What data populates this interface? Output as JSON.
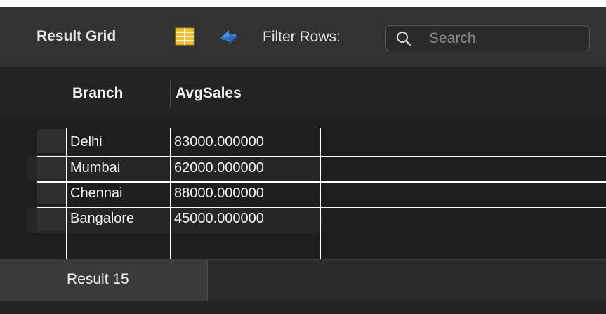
{
  "toolbar": {
    "title": "Result Grid",
    "grid_icon": "form-editor-icon",
    "refresh_icon": "refresh-icon",
    "filter_label": "Filter Rows:",
    "search_icon": "search-icon",
    "search_placeholder": "Search"
  },
  "grid": {
    "columns": [
      "Branch",
      "AvgSales"
    ],
    "rows": [
      [
        "Delhi",
        "83000.000000"
      ],
      [
        "Mumbai",
        "62000.000000"
      ],
      [
        "Chennai",
        "88000.000000"
      ],
      [
        "Bangalore",
        "45000.000000"
      ]
    ]
  },
  "tabs": [
    {
      "label": "Result 15",
      "active": true
    }
  ],
  "colors": {
    "background": "#2a2a2a",
    "grid_background": "#1e1e1e",
    "text": "#f2f2f2",
    "refresh_icon": "#3d8ee8",
    "form_icon": "#f2c230"
  }
}
